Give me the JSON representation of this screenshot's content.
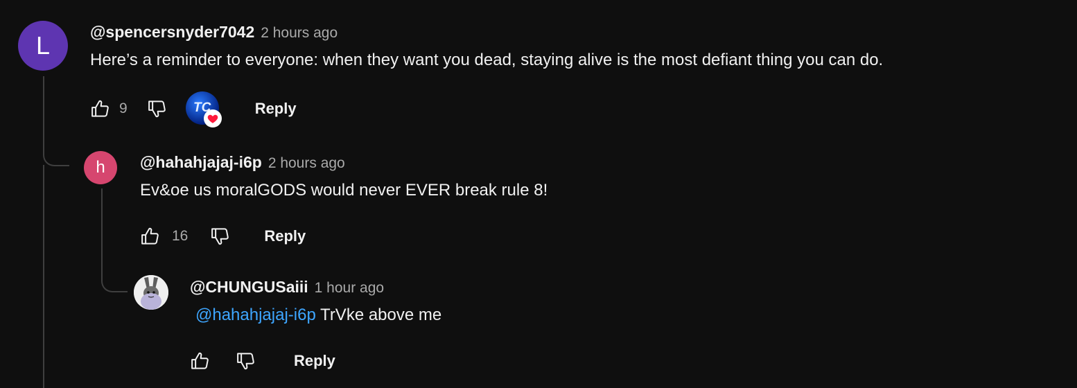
{
  "comments": [
    {
      "avatar_letter": "L",
      "avatar_color": "#5e35b1",
      "handle": "@spencersnyder7042",
      "time": "2 hours ago",
      "text": "Here’s a reminder to everyone: when they want you dead, staying alive is the most defiant thing you can do.",
      "likes": "9",
      "creator_heart": "TC",
      "reply_label": "Reply"
    },
    {
      "avatar_letter": "h",
      "avatar_color": "#d6466f",
      "handle": "@hahahjajaj-i6p",
      "time": "2 hours ago",
      "text": "Ev&oe us moralGODS would never EVER break rule 8!",
      "likes": "16",
      "reply_label": "Reply"
    },
    {
      "avatar_icon": "bunny-avatar-icon",
      "handle": "@CHUNGUSaiii",
      "time": "1 hour ago",
      "mention": "@hahahjajaj-i6p",
      "text": "TrVke above me",
      "reply_label": "Reply"
    }
  ],
  "colors": {
    "background": "#0f0f0f",
    "mention": "#3ea6ff",
    "heart": "#ff1a3c",
    "muted": "#aaaaaa"
  }
}
